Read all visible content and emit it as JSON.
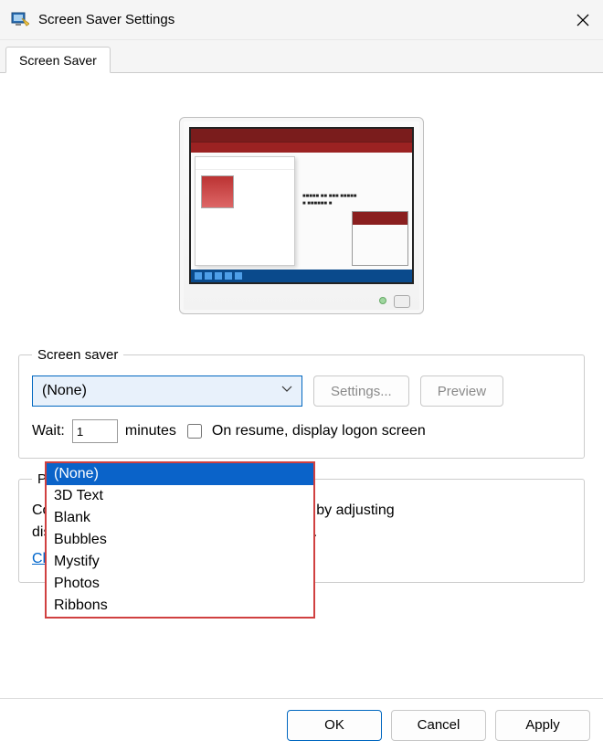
{
  "window": {
    "title": "Screen Saver Settings"
  },
  "tabs": {
    "screensaver": "Screen Saver"
  },
  "screensaver_group": {
    "legend": "Screen saver",
    "selected": "(None)",
    "settings_btn": "Settings...",
    "preview_btn": "Preview",
    "wait_label": "Wait:",
    "wait_value": "1",
    "wait_unit": "minutes",
    "resume_label": "On resume, display logon screen"
  },
  "dropdown_items": [
    "(None)",
    "3D Text",
    "Blank",
    "Bubbles",
    "Mystify",
    "Photos",
    "Ribbons"
  ],
  "dropdown_selected_index": 0,
  "power": {
    "legend": "Power management",
    "line1": "Conserve energy or maximize performance by adjusting",
    "line2": "display brightness and other power settings.",
    "link": "Change power settings"
  },
  "footer": {
    "ok": "OK",
    "cancel": "Cancel",
    "apply": "Apply"
  }
}
